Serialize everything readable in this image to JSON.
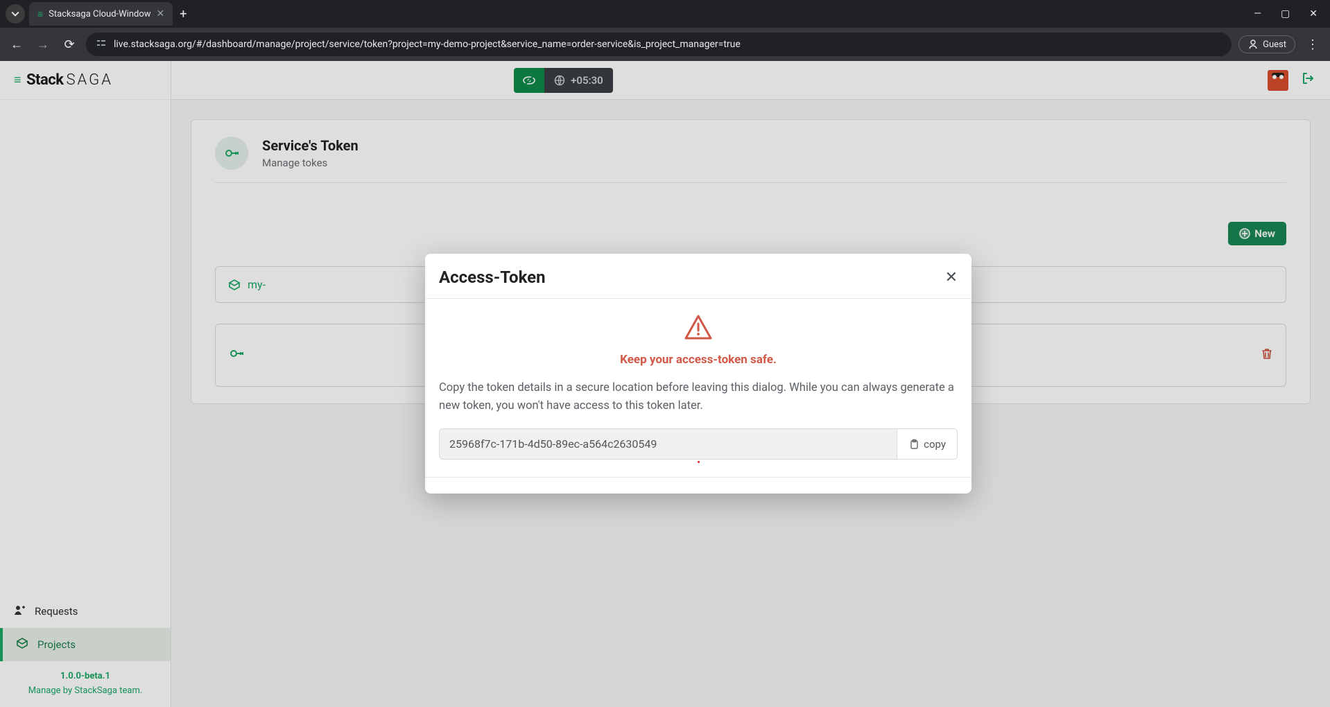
{
  "browser": {
    "tab_title": "Stacksaga Cloud-Window",
    "url": "live.stacksaga.org/#/dashboard/manage/project/service/token?project=my-demo-project&service_name=order-service&is_project_manager=true",
    "profile_label": "Guest"
  },
  "app": {
    "logo_primary": "Stack",
    "logo_secondary": "SAGA",
    "timezone": "+05:30",
    "sidebar": {
      "requests": "Requests",
      "projects": "Projects",
      "version": "1.0.0-beta.1",
      "footer": "Manage by StackSaga team."
    }
  },
  "page": {
    "title": "Service's Token",
    "subtitle": "Manage tokes",
    "new_button": "New",
    "project_item": "my-"
  },
  "modal": {
    "title": "Access-Token",
    "warning": "Keep your access-token safe.",
    "info": "Copy the token details in a secure location before leaving this dialog. While you can always generate a new token, you won't have access to this token later.",
    "token": "25968f7c-171b-4d50-89ec-a564c2630549",
    "copy_label": "copy"
  },
  "colors": {
    "accent": "#18a864",
    "danger": "#c94a3a",
    "warn_text": "#d15847"
  }
}
